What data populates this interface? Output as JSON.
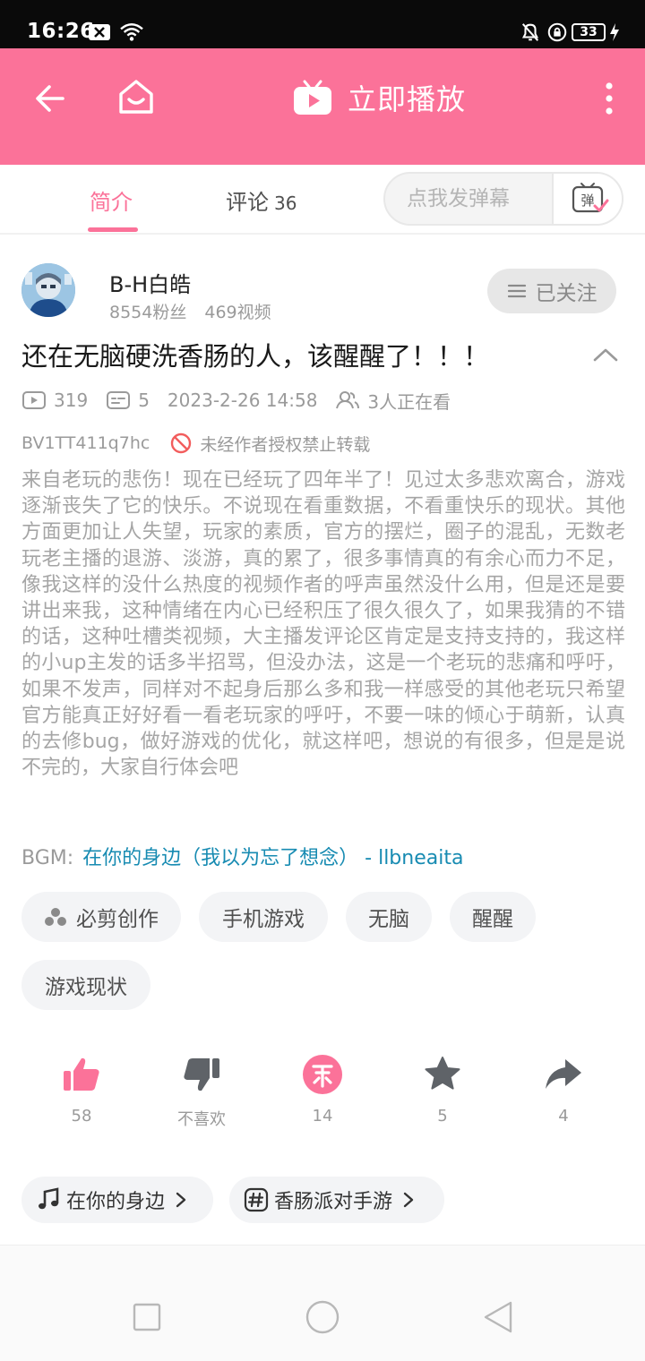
{
  "status_bar": {
    "time": "16:26",
    "battery": "33"
  },
  "header": {
    "play_now_label": "立即播放"
  },
  "tabs": [
    {
      "label": "简介"
    },
    {
      "label": "评论",
      "count": "36"
    }
  ],
  "danmaku": {
    "placeholder": "点我发弹幕",
    "button_glyph": "弹"
  },
  "uploader": {
    "name": "B-H白皓",
    "fans": "8554粉丝",
    "videos": "469视频",
    "follow_label": "已关注"
  },
  "video": {
    "title": "还在无脑硬洗香肠的人，该醒醒了！！！",
    "plays": "319",
    "danmaku_count": "5",
    "date": "2023-2-26 14:58",
    "watching": "3人正在看",
    "bvid": "BV1TT411q7hc",
    "repost_notice": "未经作者授权禁止转载",
    "description": "来自老玩的悲伤！现在已经玩了四年半了！见过太多悲欢离合，游戏逐渐丧失了它的快乐。不说现在看重数据，不看重快乐的现状。其他方面更加让人失望，玩家的素质，官方的摆烂，圈子的混乱，无数老玩老主播的退游、淡游，真的累了，很多事情真的有余心而力不足，像我这样的没什么热度的视频作者的呼声虽然没什么用，但是还是要讲出来我，这种情绪在内心已经积压了很久很久了，如果我猜的不错的话，这种吐槽类视频，大主播发评论区肯定是支持支持的，我这样的小up主发的话多半招骂，但没办法，这是一个老玩的悲痛和呼吁，如果不发声，同样对不起身后那么多和我一样感受的其他老玩只希望官方能真正好好看一看老玩家的呼吁，不要一味的倾心于萌新，认真的去修bug，做好游戏的优化，就这样吧，想说的有很多，但是是说不完的，大家自行体会吧",
    "bgm_label": "BGM:",
    "bgm_link": "在你的身边（我以为忘了想念） - llbneaita"
  },
  "tags": [
    "必剪创作",
    "手机游戏",
    "无脑",
    "醒醒",
    "游戏现状"
  ],
  "actions": {
    "like": "58",
    "dislike": "不喜欢",
    "coin": "14",
    "favorite": "5",
    "share": "4"
  },
  "chips": [
    {
      "label": "在你的身边"
    },
    {
      "label": "香肠派对手游"
    }
  ],
  "colors": {
    "accent": "#fb7299",
    "link": "#178bb2",
    "icon_gray": "#5f6368"
  }
}
